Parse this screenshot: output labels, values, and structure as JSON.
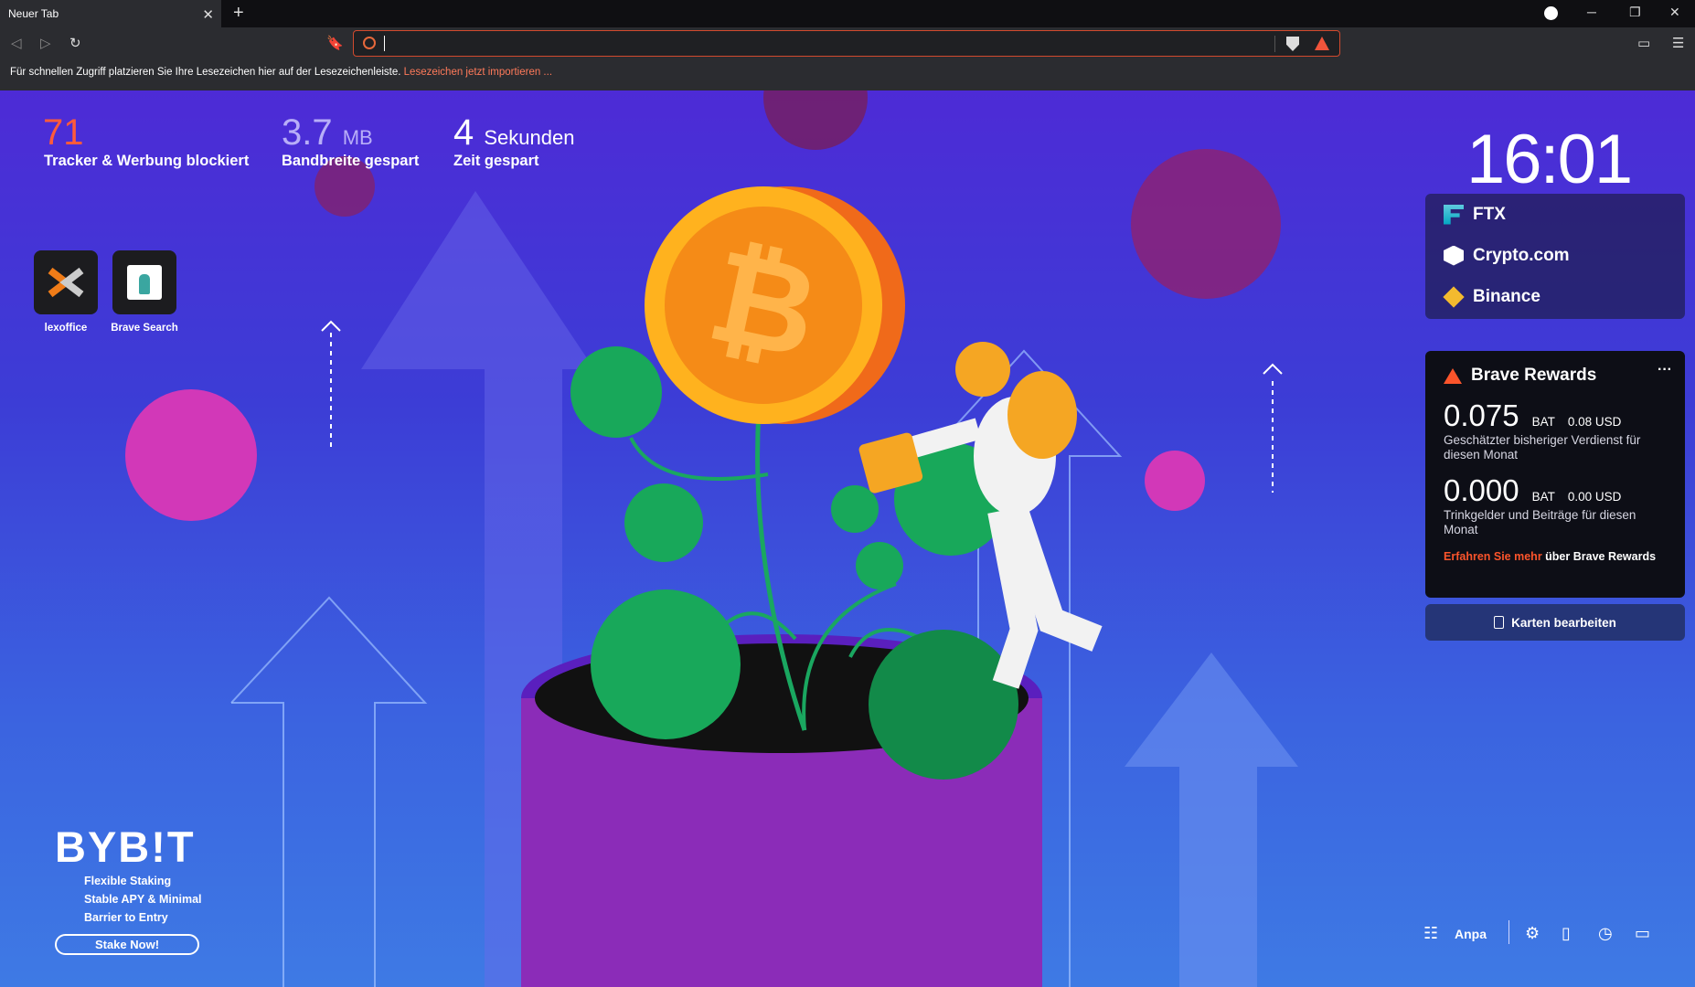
{
  "browser": {
    "tab_title": "Neuer Tab",
    "tab_close": "✕",
    "new_tab": "+",
    "bookmarks_bar_text": "Für schnellen Zugriff platzieren Sie Ihre Lesezeichen hier auf der Lesezeichenleiste.",
    "bookmarks_bar_link": "Lesezeichen jetzt importieren ..."
  },
  "stats": {
    "trackers_value": "71",
    "trackers_label": "Tracker & Werbung blockiert",
    "bandwidth_value": "3.7",
    "bandwidth_unit": "MB",
    "bandwidth_label": "Bandbreite gespart",
    "time_value": "4",
    "time_unit": "Sekunden",
    "time_label": "Zeit gespart"
  },
  "clock": "16:01",
  "top_sites": [
    {
      "label": "lexoffice"
    },
    {
      "label": "Brave Search"
    }
  ],
  "cards": [
    {
      "label": "FTX"
    },
    {
      "label": "Crypto.com"
    },
    {
      "label": "Binance"
    }
  ],
  "rewards": {
    "title": "Brave Rewards",
    "more": "···",
    "earned_value": "0.075",
    "earned_bat": "BAT",
    "earned_usd": "0.08 USD",
    "earned_desc": "Geschätzter bisheriger Verdienst für diesen Monat",
    "tips_value": "0.000",
    "tips_bat": "BAT",
    "tips_usd": "0.00 USD",
    "tips_desc": "Trinkgelder und Beiträge für diesen Monat",
    "learn_link": "Erfahren Sie mehr",
    "learn_rest": " über Brave Rewards"
  },
  "edit_cards": "Karten bearbeiten",
  "footer": {
    "customize": "Anpa"
  },
  "sponsor": {
    "logo": "BYB!T",
    "line1": "Flexible Staking",
    "line2": "Stable APY & Minimal",
    "line3": "Barrier to Entry",
    "cta": "Stake Now!"
  },
  "colors": {
    "accent": "#fb542b",
    "bg_top": "#4d2bd6",
    "bg_bottom": "#3e7ae4"
  }
}
